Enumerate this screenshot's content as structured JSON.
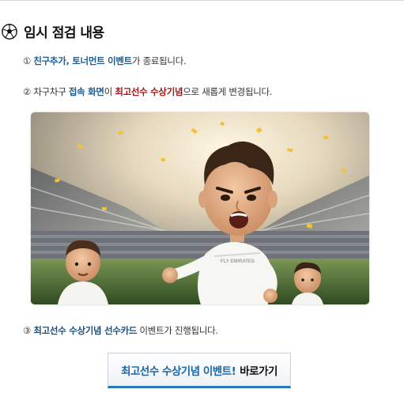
{
  "header": {
    "title": "임시 점검 내용",
    "icon": "soccer-ball-icon"
  },
  "notices": [
    {
      "marker": "①",
      "highlight": "친구추가, 토너먼트 이벤트",
      "rest": "가 종료됩니다."
    },
    {
      "marker": "②",
      "prefix": "차구차구",
      "highlight1": "접속 화면",
      "middle": "이",
      "highlight2": "최고선수 수상기념",
      "rest": "으로 새롭게 변경됩니다."
    },
    {
      "marker": "③",
      "highlight": "최고선수 수상기념 선수카드",
      "rest": "이벤트가 진행됩니다."
    }
  ],
  "banner": {
    "image": "stadium-soccer-players-illustration",
    "jersey_text": "FLY EMIRATES"
  },
  "event_button": {
    "main_label": "최고선수 수상기념 이벤트!",
    "link_label": "바로가기"
  },
  "colors": {
    "highlight_blue": "#1c5f94",
    "highlight_red": "#a31414",
    "button_accent": "#2c78b4"
  }
}
